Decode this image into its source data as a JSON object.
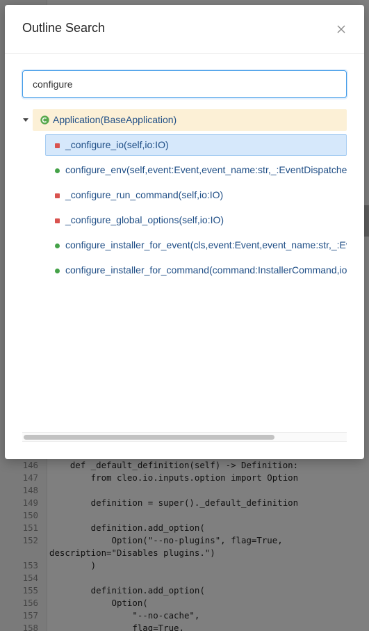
{
  "modal": {
    "title": "Outline Search",
    "close_icon": "close-icon",
    "search": {
      "value": "configure",
      "placeholder": ""
    },
    "tree": {
      "root": {
        "icon": "class-icon",
        "label": "Application(BaseApplication)",
        "expanded": true
      },
      "items": [
        {
          "label": "_configure_io(self,io:IO)",
          "visibility": "private",
          "selected": true
        },
        {
          "label": "configure_env(self,event:Event,event_name:str,_:EventDispatcher)",
          "visibility": "public",
          "selected": false
        },
        {
          "label": "_configure_run_command(self,io:IO)",
          "visibility": "private",
          "selected": false
        },
        {
          "label": "_configure_global_options(self,io:IO)",
          "visibility": "private",
          "selected": false
        },
        {
          "label": "configure_installer_for_event(cls,event:Event,event_name:str,_:EventDispatcher)",
          "visibility": "public",
          "selected": false
        },
        {
          "label": "configure_installer_for_command(command:InstallerCommand,io:IO)",
          "visibility": "public",
          "selected": false
        }
      ]
    },
    "scroll": {
      "horizontal_fraction": 0.78
    }
  },
  "colors": {
    "accent": "#3f9ae8",
    "root_highlight": "#fcf0d6",
    "selected_row": "#d6e8fb",
    "private_method": "#d9534f",
    "public_method": "#45a248"
  },
  "editor": {
    "lines": [
      {
        "no": "146",
        "text": "    def _default_definition(self) -> Definition:"
      },
      {
        "no": "147",
        "text": "        from cleo.io.inputs.option import Option"
      },
      {
        "no": "148",
        "text": ""
      },
      {
        "no": "149",
        "text": "        definition = super()._default_definition"
      },
      {
        "no": "150",
        "text": ""
      },
      {
        "no": "151",
        "text": "        definition.add_option("
      },
      {
        "no": "152",
        "text": "            Option(\"--no-plugins\", flag=True,"
      },
      {
        "no": "",
        "text": "description=\"Disables plugins.\")"
      },
      {
        "no": "153",
        "text": "        )"
      },
      {
        "no": "154",
        "text": ""
      },
      {
        "no": "155",
        "text": "        definition.add_option("
      },
      {
        "no": "156",
        "text": "            Option("
      },
      {
        "no": "157",
        "text": "                \"--no-cache\","
      },
      {
        "no": "158",
        "text": "                flag=True,"
      }
    ]
  }
}
